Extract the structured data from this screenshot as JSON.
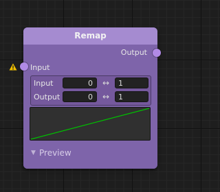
{
  "node": {
    "title": "Remap",
    "output_port_label": "Output",
    "input_port_label": "Input"
  },
  "ranges": {
    "input": {
      "label": "Input",
      "min": "0",
      "max": "1"
    },
    "output": {
      "label": "Output",
      "min": "0",
      "max": "1"
    },
    "swap_icon": "↔"
  },
  "curve": {
    "color": "#00c000",
    "points": [
      [
        0,
        0
      ],
      [
        1,
        1
      ]
    ]
  },
  "preview": {
    "label": "Preview",
    "arrow_icon": "▼"
  },
  "icons": {
    "warning": "warning-icon",
    "swap": "double-arrow-icon",
    "collapse": "triangle-down-icon"
  },
  "colors": {
    "node_body": "#7e64aa",
    "node_header": "#a58bd0",
    "port": "#b18ae6",
    "warning": "#f0c000"
  }
}
